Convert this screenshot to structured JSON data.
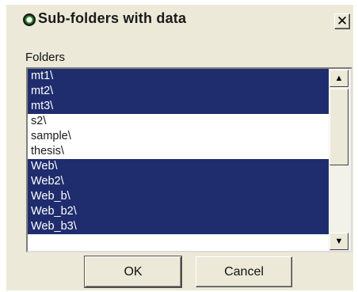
{
  "window": {
    "title": "Sub-folders with data",
    "close_label": "✕"
  },
  "folders_label": "Folders",
  "folders": [
    {
      "label": "mt1\\",
      "selected": true
    },
    {
      "label": "mt2\\",
      "selected": true
    },
    {
      "label": "mt3\\",
      "selected": true
    },
    {
      "label": "s2\\",
      "selected": false
    },
    {
      "label": "sample\\",
      "selected": false
    },
    {
      "label": "thesis\\",
      "selected": false
    },
    {
      "label": "Web\\",
      "selected": true
    },
    {
      "label": "Web2\\",
      "selected": true
    },
    {
      "label": "Web_b\\",
      "selected": true
    },
    {
      "label": "Web_b2\\",
      "selected": true
    },
    {
      "label": "Web_b3\\",
      "selected": true
    }
  ],
  "scrollbar": {
    "up_glyph": "▲",
    "down_glyph": "▼"
  },
  "buttons": {
    "ok_label": "OK",
    "cancel_label": "Cancel"
  },
  "colors": {
    "selection": "#1f2d6e",
    "dialog_bg": "#ece9d8"
  }
}
